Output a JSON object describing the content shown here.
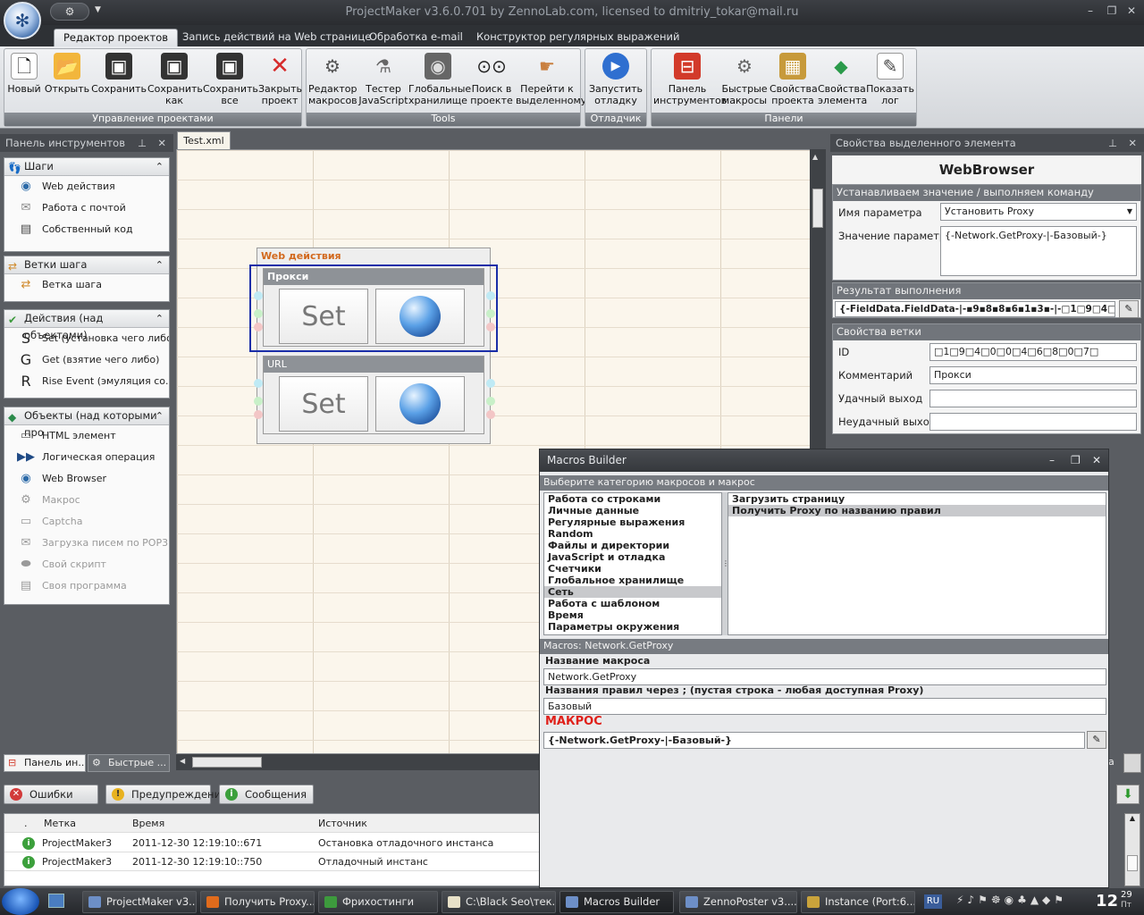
{
  "window": {
    "title": "ProjectMaker v3.6.0.701 by ZennoLab.com, licensed to dmitriy_tokar@mail.ru",
    "qat_label": "⚙"
  },
  "ribbon_tabs": [
    "Редактор проектов",
    "Запись действий на Web странице",
    "Обработка e-mail",
    "Конструктор регулярных выражений"
  ],
  "ribbon_groups": [
    {
      "label": "Управление проектами",
      "buttons": [
        {
          "label": "Новый",
          "icon": "new-file-icon"
        },
        {
          "label": "Открыть",
          "icon": "folder-open-icon"
        },
        {
          "label": "Сохранить",
          "icon": "floppy-icon"
        },
        {
          "label": "Сохранить как",
          "icon": "floppy-edit-icon"
        },
        {
          "label": "Сохранить все",
          "icon": "floppy-multi-icon"
        },
        {
          "label": "Закрыть проект",
          "icon": "close-x-icon"
        }
      ]
    },
    {
      "label": "Tools",
      "buttons": [
        {
          "label": "Редактор макросов",
          "icon": "gear-icon"
        },
        {
          "label": "Тестер JavaScript",
          "icon": "flask-icon"
        },
        {
          "label": "Глобальные хранилище",
          "icon": "safe-icon"
        },
        {
          "label": "Поиск в проекте",
          "icon": "binoculars-icon"
        },
        {
          "label": "Перейти к выделенному",
          "icon": "pointer-hand-icon"
        }
      ]
    },
    {
      "label": "Отладчик",
      "buttons": [
        {
          "label": "Запустить отладку",
          "icon": "play-icon"
        }
      ]
    },
    {
      "label": "Панели",
      "buttons": [
        {
          "label": "Панель инструментов",
          "icon": "toolbox-icon"
        },
        {
          "label": "Быстрые макросы",
          "icon": "gears-icon"
        },
        {
          "label": "Свойства проекта",
          "icon": "box-info-icon"
        },
        {
          "label": "Свойства элемента",
          "icon": "shapes-icon"
        },
        {
          "label": "Показать лог",
          "icon": "log-icon"
        }
      ]
    }
  ],
  "left_panel": {
    "title": "Панель инструментов",
    "sections": [
      {
        "title": "Шаги",
        "icon": "footprints-icon",
        "items": [
          {
            "label": "Web действия",
            "icon": "globe-icon",
            "disabled": false
          },
          {
            "label": "Работа с почтой",
            "icon": "mail-icon",
            "disabled": false
          },
          {
            "label": "Собственный код",
            "icon": "code-icon",
            "disabled": false
          }
        ]
      },
      {
        "title": "Ветки шага",
        "icon": "branch-icon",
        "items": [
          {
            "label": "Ветка шага",
            "icon": "branch-arrows-icon",
            "disabled": false
          }
        ]
      },
      {
        "title": "Действия (над объектами)",
        "icon": "check-icon",
        "items": [
          {
            "label": "Set (установка чего либо)",
            "icon": "S",
            "disabled": false
          },
          {
            "label": "Get (взятие чего либо)",
            "icon": "G",
            "disabled": false
          },
          {
            "label": "Rise Event (эмуляция со...",
            "icon": "R",
            "disabled": false
          }
        ]
      },
      {
        "title": "Объекты (над которыми про",
        "icon": "objects-icon",
        "items": [
          {
            "label": "HTML элемент",
            "icon": "html-icon",
            "disabled": false
          },
          {
            "label": "Логическая операция",
            "icon": "logic-icon",
            "disabled": false
          },
          {
            "label": "Web Browser",
            "icon": "browser-globe-icon",
            "disabled": false
          },
          {
            "label": "Макрос",
            "icon": "macro-gear-icon",
            "disabled": true
          },
          {
            "label": "Captcha",
            "icon": "captcha-icon",
            "disabled": true
          },
          {
            "label": "Загрузка писем по POP3",
            "icon": "pop3-icon",
            "disabled": true
          },
          {
            "label": "Свой скрипт",
            "icon": "script-icon",
            "disabled": true
          },
          {
            "label": "Своя программа",
            "icon": "program-icon",
            "disabled": true
          }
        ]
      }
    ],
    "bottom_tabs": [
      "Панель ин...",
      "Быстрые ..."
    ]
  },
  "document": {
    "tab": "Test.xml",
    "block_title": "Web действия",
    "sub_blocks": [
      {
        "title": "Прокси",
        "set_label": "Set"
      },
      {
        "title": "URL",
        "set_label": "Set"
      }
    ]
  },
  "right_panel": {
    "title": "Свойства выделенного элемента",
    "element_name": "WebBrowser",
    "group1": {
      "head": "Устанавливаем значение / выполняем команду",
      "param_name_label": "Имя параметра",
      "param_name_value": "Установить Proxy",
      "param_value_label": "Значение параметра",
      "param_value": "{-Network.GetProxy-|-Базовый-}"
    },
    "group2": {
      "head": "Результат выполнения",
      "value": "{-FieldData.FieldData-|-▪9▪8▪8▪6▪1▪3▪-|-□1□9□4□"
    },
    "group3": {
      "head": "Свойства ветки",
      "id_label": "ID",
      "id_value": "□1□9□4□0□0□4□6□8□0□7□",
      "comment_label": "Комментарий",
      "comment_value": "Прокси",
      "success_label": "Удачный выход",
      "success_value": "",
      "fail_label": "Неудачный выход",
      "fail_value": ""
    },
    "hidden_fragment": "а"
  },
  "macros_builder": {
    "title": "Macros Builder",
    "category_head": "Выберите категорию макросов и макрос",
    "categories": [
      "Работа со строками",
      "Личные данные",
      "Регулярные выражения",
      "Random",
      "Файлы и директории",
      "JavaScript и отладка",
      "Счетчики",
      "Глобальное хранилище",
      "Сеть",
      "Работа с шаблоном",
      "Время",
      "Параметры окружения"
    ],
    "selected_category": "Сеть",
    "macros": [
      "Загрузить страницу",
      "Получить Proxy по названию правил"
    ],
    "selected_macro": "Получить Proxy по названию правил",
    "macro_head": "Macros: Network.GetProxy",
    "name_label": "Название макроса",
    "name_value": "Network.GetProxy",
    "rules_label": "Названия правил через ; (пустая строка - любая доступная Proxy)",
    "rules_value": "Базовый",
    "macro_label": "МАКРОС",
    "macro_value": "{-Network.GetProxy-|-Базовый-}"
  },
  "bottom_panel": {
    "buttons": [
      {
        "label": "Ошибки",
        "color": "#d23a3a",
        "glyph": "✕"
      },
      {
        "label": "Предупреждения",
        "color": "#e8b21f",
        "glyph": "!"
      },
      {
        "label": "Сообщения",
        "color": "#3ca03c",
        "glyph": "i"
      }
    ],
    "columns": [
      ".",
      "Метка",
      "Время",
      "Источник"
    ],
    "rows": [
      {
        "label": "ProjectMaker3",
        "time": "2011-12-30   12:19:10::671",
        "source": "Остановка отладочного инстанса"
      },
      {
        "label": "ProjectMaker3",
        "time": "2011-12-30   12:19:10::750",
        "source": "Отладочный инстанс"
      }
    ]
  },
  "taskbar": {
    "items": [
      {
        "label": "ProjectMaker v3...",
        "active": false,
        "color": "#6d8fc7"
      },
      {
        "label": "Получить Proxy...",
        "active": false,
        "color": "#e06b1c"
      },
      {
        "label": "Фрихостинги",
        "active": false,
        "color": "#3d9a3d"
      },
      {
        "label": "C:\\Black Seo\\тек...",
        "active": false,
        "color": "#e8e1c8"
      },
      {
        "label": "Macros Builder",
        "active": true,
        "color": "#6d8fc7"
      },
      {
        "label": "ZennoPoster v3....",
        "active": false,
        "color": "#6d8fc7"
      },
      {
        "label": "Instance (Port:6...",
        "active": false,
        "color": "#c9a33b"
      }
    ],
    "lang": "RU",
    "clock_time": "12",
    "clock_min": "29",
    "clock_day": "Пт"
  }
}
